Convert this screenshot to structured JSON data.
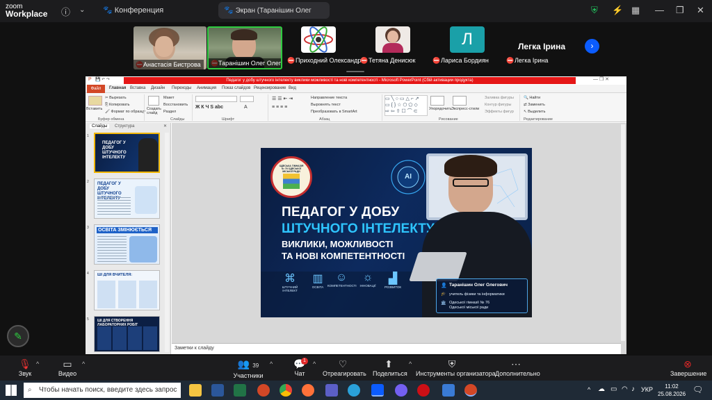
{
  "zoom": {
    "logo_line1": "zoom",
    "logo_line2": "Workplace",
    "tab_conference": "Конференция",
    "tab_screen": "Экран (Таранішин Олег Олегові"
  },
  "participants": {
    "video": [
      {
        "name": "Анастасія Бистрова"
      },
      {
        "name": "Таранішин Олег Олегович"
      }
    ],
    "avatars": [
      {
        "name": "Приходний Олександр"
      },
      {
        "name": "Тетяна Денисюк"
      },
      {
        "name": "Лариса Бордиян",
        "initial": "Л"
      },
      {
        "name": "Легка Ірина",
        "headline": "Легка Ірина"
      }
    ]
  },
  "ppt": {
    "title_bar": "Педагог у добу штучного інтелекту виклики можливості та нові компетентності - Microsoft PowerPoint (Сбій активации продукта)",
    "tabs": [
      "Файл",
      "Главная",
      "Вставка",
      "Дизайн",
      "Переходы",
      "Анимация",
      "Показ слайдов",
      "Рецензирование",
      "Вид"
    ],
    "groups": {
      "clipboard": "Буфер обмена",
      "slides": "Слайды",
      "font": "Шрифт",
      "paragraph": "Абзац",
      "drawing": "Рисование",
      "editing": "Редактирование"
    },
    "buttons": {
      "paste": "Вставить",
      "cut": "Вырезать",
      "copy": "Копировать",
      "format_painter": "Формат по образцу",
      "new_slide": "Создать слайд",
      "layout": "Макет",
      "reset": "Восстановить",
      "section": "Раздел",
      "text_direction": "Направление текста",
      "align_text": "Выровнять текст",
      "smartart": "Преобразовать в SmartArt",
      "arrange": "Упорядочить",
      "quick_styles": "Экспресс-стили",
      "shape_fill": "Заливка фигуры",
      "shape_outline": "Контур фигуры",
      "shape_effects": "Эффекты фигур",
      "find": "Найти",
      "replace": "Заменить",
      "select": "Выделить"
    },
    "panel_tabs": [
      "Слайды",
      "Структура"
    ],
    "notes_placeholder": "Заметки к слайду"
  },
  "slide": {
    "school_badge": "ОДЕСЬКА ГІМНАЗІЯ № 76 ОДЕСЬКОЇ МІСЬКОЇ РАДИ",
    "ai_badge": "AI",
    "title_line1": "ПЕДАГОГ У ДОБУ",
    "title_line2": "ШТУЧНОГО ІНТЕЛЕКТУ:",
    "subtitle_line1": "ВИКЛИКИ, МОЖЛИВОСТІ",
    "subtitle_line2": "ТА НОВІ КОМПЕТЕНТНОСТІ",
    "icons": [
      {
        "label": "ШТУЧНИЙ ІНТЕЛЕКТ",
        "icon": "brain-icon"
      },
      {
        "label": "ОСВІТА",
        "icon": "book-icon"
      },
      {
        "label": "КОМПЕТЕНТНОСТІ",
        "icon": "people-icon"
      },
      {
        "label": "ІННОВАЦІЇ",
        "icon": "lightbulb-icon"
      },
      {
        "label": "РОЗВИТОК",
        "icon": "growth-icon"
      }
    ],
    "author_name": "Таранішин Олег Олегович",
    "author_role": "учитель фізики та інформатики",
    "author_school": "Одеської гімназії № 76 Одеської міської ради"
  },
  "thumbnails": [
    {
      "num": "1",
      "title": "ПЕДАГОГ У ДОБУ ШТУЧНОГО ІНТЕЛЕКТУ"
    },
    {
      "num": "2",
      "title": "ПЕДАГОГ У ДОБУ ШТУЧНОГО ІНТЕЛЕКТУ"
    },
    {
      "num": "3",
      "title": "ОСВІТА ЗМІНЮЄТЬСЯ"
    },
    {
      "num": "4",
      "title": "ШІ ДЛЯ ВЧИТЕЛЯ:"
    },
    {
      "num": "5",
      "title": "ШІ ДЛЯ СТВОРЕННЯ ЛАБОРАТОРНИХ РОБІТ"
    }
  ],
  "toolbar": {
    "audio": "Звук",
    "video": "Видео",
    "participants": "Участники",
    "participants_count": "39",
    "chat": "Чат",
    "chat_badge": "1",
    "react": "Отреагировать",
    "share": "Поделиться",
    "host_tools": "Инструменты организатора",
    "more": "Дополнительно",
    "end": "Завершение"
  },
  "taskbar": {
    "search_placeholder": "Чтобы начать поиск, введите здесь запрос",
    "lang": "УКР",
    "time": "11:02",
    "date": "25.08.2026"
  },
  "colors": {
    "zoom_bg": "#1c1c1e",
    "accent_blue": "#0b5cff",
    "slide_cyan": "#2ec5ff",
    "end_red": "#e02828",
    "ppt_red": "#e51616"
  }
}
